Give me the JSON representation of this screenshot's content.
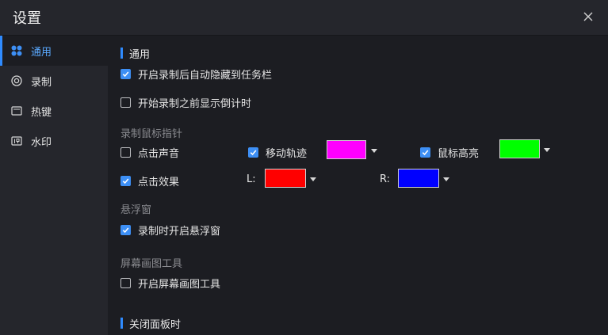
{
  "window": {
    "title": "设置"
  },
  "sidebar": {
    "items": [
      {
        "label": "通用",
        "icon": "grid-icon",
        "active": true
      },
      {
        "label": "录制",
        "icon": "record-icon",
        "active": false
      },
      {
        "label": "热键",
        "icon": "keyboard-icon",
        "active": false
      },
      {
        "label": "水印",
        "icon": "watermark-icon",
        "active": false
      }
    ]
  },
  "general": {
    "heading": "通用",
    "options": [
      {
        "label": "开启录制后自动隐藏到任务栏",
        "checked": true
      },
      {
        "label": "开始录制之前显示倒计时",
        "checked": false
      }
    ]
  },
  "mouse": {
    "heading": "录制鼠标指针",
    "click_sound": {
      "label": "点击声音",
      "checked": false
    },
    "move_track": {
      "label": "移动轨迹",
      "checked": true,
      "color": "#ff00ff"
    },
    "highlight": {
      "label": "鼠标高亮",
      "checked": true,
      "color": "#00ff00"
    },
    "click_effect": {
      "label": "点击效果",
      "checked": true
    },
    "left": {
      "label": "L:",
      "color": "#ff0000"
    },
    "right": {
      "label": "R:",
      "color": "#0000ff"
    }
  },
  "floating": {
    "heading": "悬浮窗",
    "option": {
      "label": "录制时开启悬浮窗",
      "checked": true
    }
  },
  "drawing": {
    "heading": "屏幕画图工具",
    "option": {
      "label": "开启屏幕画图工具",
      "checked": false
    }
  },
  "close_panel": {
    "heading": "关闭面板时"
  },
  "colors": {
    "accent": "#2f8bff",
    "checkbox_on": "#3d8ff5",
    "background": "#1c1d22",
    "sidebar": "#25262c"
  }
}
